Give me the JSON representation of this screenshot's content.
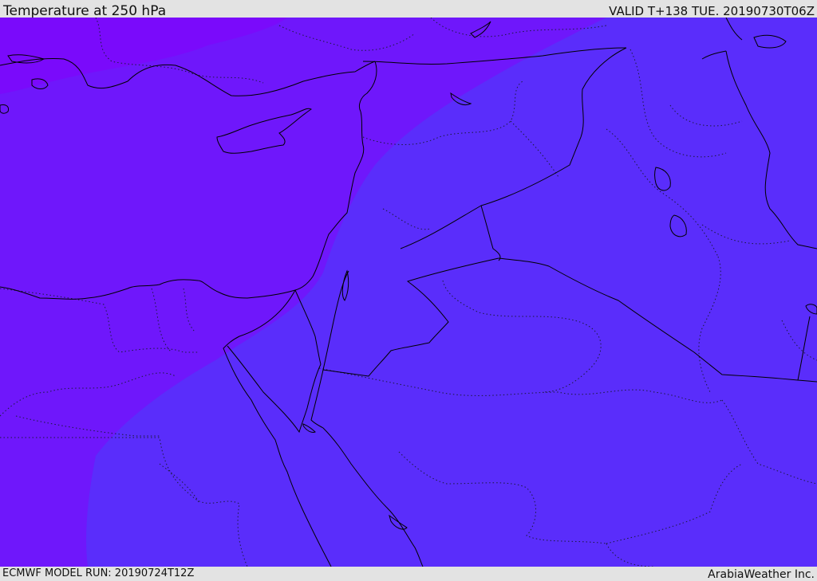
{
  "header": {
    "title": "Temperature at 250 hPa",
    "valid_time": "VALID T+138 TUE. 20190730T06Z"
  },
  "footer": {
    "model_run": "ECMWF MODEL RUN: 20190724T12Z",
    "credit": "ArabiaWeather Inc."
  },
  "map": {
    "field_colors": {
      "warmer_band": "#5a2dfb",
      "cooler_band": "#6f17fb",
      "coldest_corner": "#7a0afb"
    },
    "line_colors": {
      "coastline": "#000000",
      "international_border": "#000000",
      "internal_border": "#1a1a3a"
    }
  }
}
